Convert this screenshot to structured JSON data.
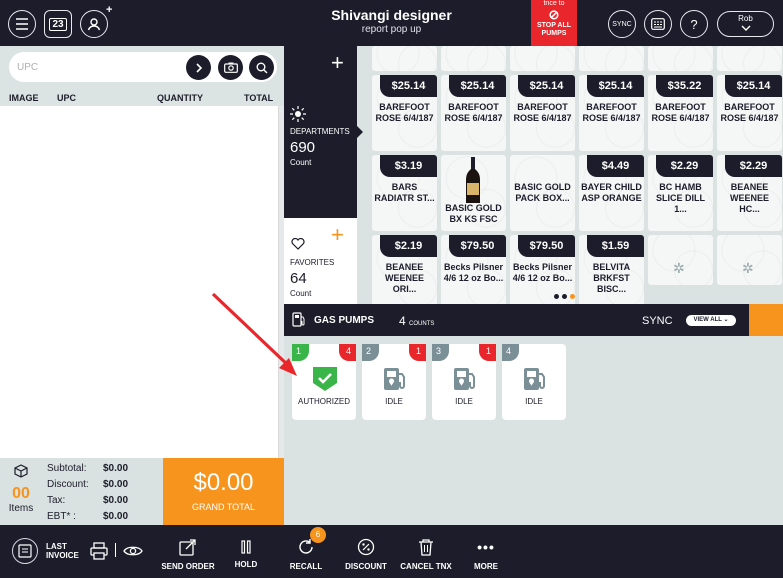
{
  "topbar": {
    "title": "Shivangi designer",
    "subtitle": "report pop up",
    "calendar_day": "23",
    "add_symbol": "+",
    "stop_pumps": {
      "top_text": "trice to",
      "label": "STOP ALL PUMPS"
    },
    "sync_label": "SYNC",
    "help_label": "?",
    "user_name": "Rob",
    "icons": [
      "menu-icon",
      "calendar-icon",
      "user-add-icon",
      "stop-icon",
      "sync-icon",
      "keypad-icon",
      "help-icon",
      "chevron-down-icon"
    ]
  },
  "invoice": {
    "search_placeholder": "UPC",
    "columns": [
      "IMAGE",
      "UPC",
      "QUANTITY",
      "TOTAL"
    ],
    "items_count": "00",
    "items_label": "Items",
    "totals": [
      {
        "label": "Subtotal:",
        "value": "$0.00"
      },
      {
        "label": "Discount:",
        "value": "$0.00"
      },
      {
        "label": "Tax:",
        "value": "$0.00"
      },
      {
        "label": "EBT* :",
        "value": "$0.00"
      }
    ],
    "grand_total": "$0.00",
    "grand_total_label": "GRAND TOTAL"
  },
  "departments": {
    "label": "DEPARTMENTS",
    "count": "690",
    "count_label": "Count",
    "add": "+"
  },
  "favorites": {
    "label": "FAVORITES",
    "count": "64",
    "count_label": "Count",
    "add": "+"
  },
  "products": [
    {
      "price": "$25.14",
      "name": "BAREFOOT ROSE 6/4/187"
    },
    {
      "price": "$25.14",
      "name": "BAREFOOT ROSE 6/4/187"
    },
    {
      "price": "$25.14",
      "name": "BAREFOOT ROSE 6/4/187"
    },
    {
      "price": "$25.14",
      "name": "BAREFOOT ROSE 6/4/187"
    },
    {
      "price": "$35.22",
      "name": "BAREFOOT ROSE 6/4/187"
    },
    {
      "price": "$25.14",
      "name": "BAREFOOT ROSE 6/4/187"
    },
    {
      "price": "$3.19",
      "name": "BARS RADIATR ST..."
    },
    {
      "price": "",
      "name": "BASIC GOLD BX KS FSC"
    },
    {
      "price": "",
      "name": "BASIC GOLD PACK BOX..."
    },
    {
      "price": "$4.49",
      "name": "BAYER CHILD ASP ORANGE"
    },
    {
      "price": "$2.29",
      "name": "BC HAMB SLICE DILL 1..."
    },
    {
      "price": "$2.29",
      "name": "BEANEE WEENEE HC..."
    },
    {
      "price": "$2.19",
      "name": "BEANEE WEENEE ORI..."
    },
    {
      "price": "$79.50",
      "name": "Becks Pilsner 4/6 12 oz Bo..."
    },
    {
      "price": "$79.50",
      "name": "Becks Pilsner 4/6 12 oz Bo..."
    },
    {
      "price": "$1.59",
      "name": "BELVITA BRKFST BISC..."
    },
    {
      "price": "",
      "name": ""
    },
    {
      "price": "",
      "name": ""
    }
  ],
  "pagination": {
    "pages": 3,
    "active": 3
  },
  "gas": {
    "title": "GAS PUMPS",
    "count": "4",
    "count_label": "COUNTS",
    "sync": "SYNC",
    "view_all": "VIEW ALL",
    "pumps": [
      {
        "number": "1",
        "badge": "4",
        "status": "AUTHORIZED",
        "color": "#3ab54a"
      },
      {
        "number": "2",
        "badge": "1",
        "status": "IDLE",
        "color": "#7b8f96"
      },
      {
        "number": "3",
        "badge": "1",
        "status": "IDLE",
        "color": "#7b8f96"
      },
      {
        "number": "4",
        "badge": "",
        "status": "IDLE",
        "color": "#7b8f96"
      }
    ]
  },
  "toolbar": {
    "last_invoice": "LAST INVOICE",
    "send_order": "SEND ORDER",
    "hold": "HOLD",
    "recall": "RECALL",
    "recall_badge": "6",
    "discount": "DISCOUNT",
    "cancel_tnx": "CANCEL TNX",
    "more": "MORE"
  },
  "colors": {
    "dark": "#1c1c2a",
    "accent": "#f7941d",
    "danger": "#e8262b",
    "success": "#3ab54a",
    "panel": "#dbe2e2"
  }
}
